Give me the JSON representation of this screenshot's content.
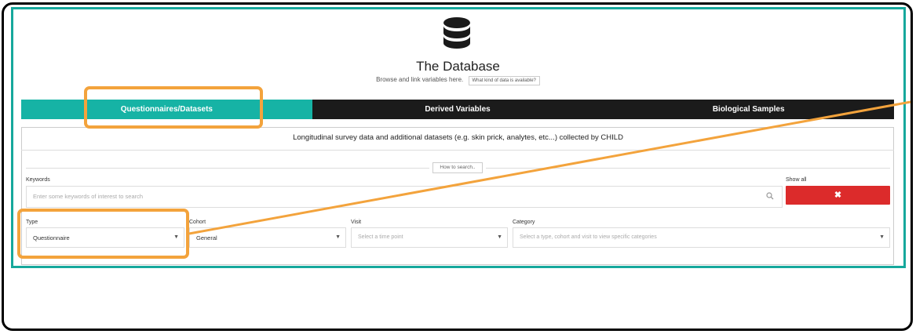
{
  "header": {
    "title": "The Database",
    "subtitle": "Browse and link variables here.",
    "help_button": "What kind of data is available?"
  },
  "tabs": [
    {
      "label": "Questionnaires/Datasets",
      "active": true
    },
    {
      "label": "Derived Variables",
      "active": false
    },
    {
      "label": "Biological Samples",
      "active": false
    }
  ],
  "panel": {
    "description": "Longitudinal survey data and additional datasets (e.g. skin prick, analytes, etc...) collected by CHILD",
    "howto_button": "How to search..",
    "keywords_label": "Keywords",
    "search_placeholder": "Enter some keywords of interest to search",
    "show_all_label": "Show all",
    "clear_button_glyph": "✖"
  },
  "filters": {
    "type": {
      "label": "Type",
      "value": "Questionnaire"
    },
    "cohort": {
      "label": "Cohort",
      "value": "General"
    },
    "visit": {
      "label": "Visit",
      "placeholder": "Select a time point"
    },
    "category": {
      "label": "Category",
      "placeholder": "Select a type, cohort and visit to view specific categories"
    }
  },
  "colors": {
    "accent": "#16b3a5",
    "annotation": "#f3a33c",
    "danger": "#dc2b2b",
    "tab_dark": "#1b1b1b"
  },
  "icons": {
    "database": "database-icon",
    "search": "search-icon",
    "clear": "close-icon",
    "caret": "caret-down-icon"
  }
}
